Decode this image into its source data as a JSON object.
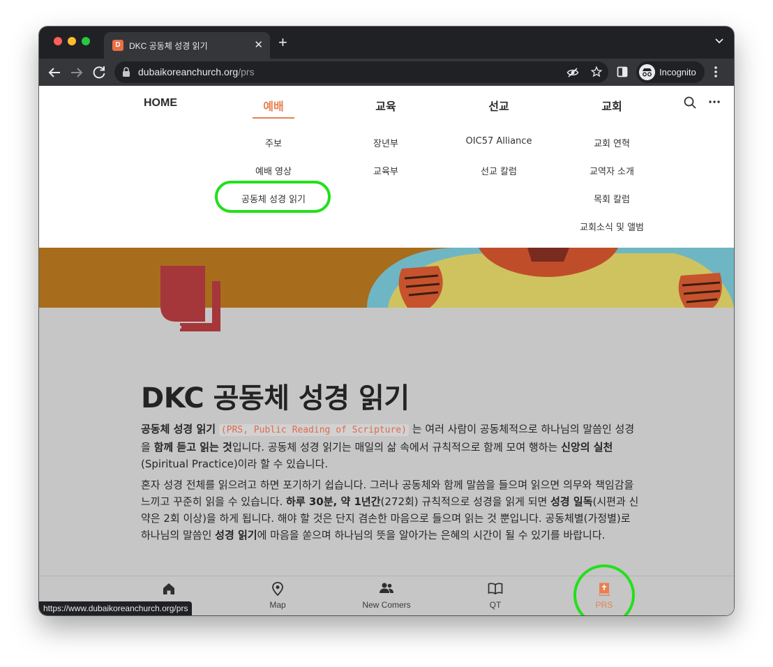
{
  "browser": {
    "tab_title": "DKC 공동체 성경 읽기",
    "favicon_letter": "D",
    "url_host": "dubaikoreanchurch.org",
    "url_path": "/prs",
    "profile_label": "Incognito",
    "status_url": "https://www.dubaikoreanchurch.org/prs"
  },
  "nav": {
    "top": [
      {
        "label": "HOME"
      },
      {
        "label": "예배"
      },
      {
        "label": "교육"
      },
      {
        "label": "선교"
      },
      {
        "label": "교회"
      }
    ],
    "worship": [
      "주보",
      "예배 영상",
      "공동체 성경 읽기"
    ],
    "education": [
      "장년부",
      "교육부"
    ],
    "mission": [
      "OIC57 Alliance",
      "선교 칼럼"
    ],
    "church": [
      "교회 연혁",
      "교역자 소개",
      "목회 칼럼",
      "교회소식 및 앨범"
    ]
  },
  "article": {
    "title": "DKC 공동체 성경 읽기",
    "p1": {
      "b1": "공동체 성경 읽기",
      "code": "(PRS, Public Reading of Scripture)",
      "t1": " 는 여러 사람이 공동체적으로 하나님의 말씀인 성경을 ",
      "b2": "함께 듣고 읽는 것",
      "t2": "입니다. 공동체 성경 읽기는 매일의 삶 속에서 규칙적으로 함께 모여 행하는 ",
      "b3": "신앙의 실천",
      "t3": "(Spiritual Practice)이라 할 수 있습니다."
    },
    "p2": {
      "t1": "혼자 성경 전체를 읽으려고 하면 포기하기 쉽습니다. 그러나 공동체와 함께 말씀을 들으며 읽으면 의무와 책임감을 느끼고 꾸준히 읽을 수 있습니다. ",
      "b1": "하루 30분, 약 1년간",
      "t2": "(272회) 규칙적으로 성경을 읽게 되면 ",
      "b2": "성경 일독",
      "t3": "(시편과 신약은 2회 이상)을 하게 됩니다. 해야 할 것은 단지 겸손한 마음으로 들으며 읽는 것 뿐입니다. 공동체별(가정별)로 하나님의 말씀인 ",
      "b3": "성경 읽기",
      "t4": "에 마음을 쏟으며 하나님의 뜻을 알아가는 은혜의 시간이 될 수 있기를 바랍니다."
    }
  },
  "bottom_nav": [
    {
      "label": "",
      "icon": "home-icon"
    },
    {
      "label": "Map",
      "icon": "map-pin-icon"
    },
    {
      "label": "New Comers",
      "icon": "people-icon"
    },
    {
      "label": "QT",
      "icon": "open-book-icon"
    },
    {
      "label": "PRS",
      "icon": "bible-icon"
    }
  ],
  "colors": {
    "accent": "#e8804f",
    "highlight": "#22e01a",
    "logo_red": "#a5363a"
  }
}
